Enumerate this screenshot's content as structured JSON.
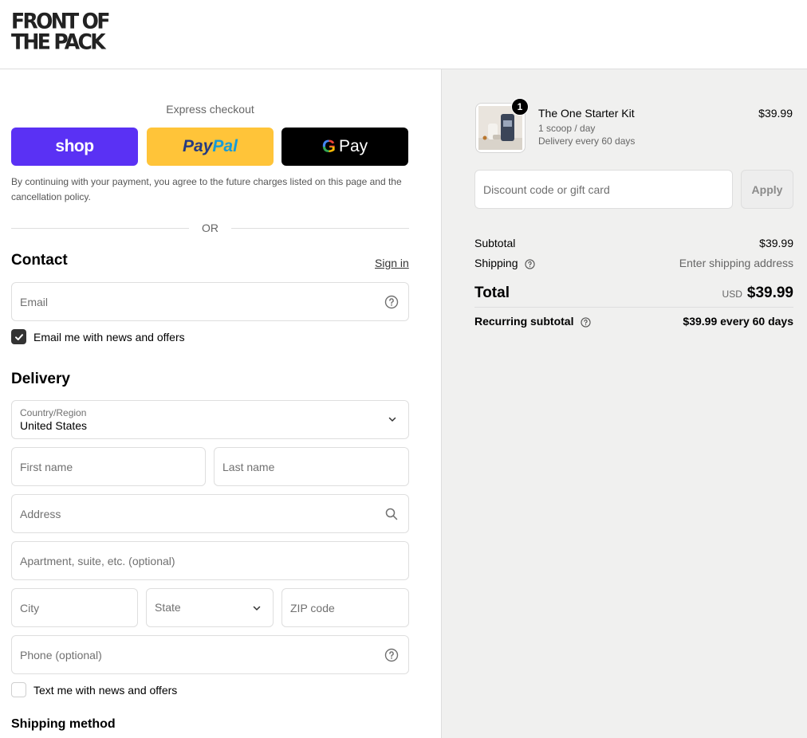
{
  "brand": {
    "logo_line1": "FRONT OF",
    "logo_line2": "THE PACK"
  },
  "express": {
    "title": "Express checkout",
    "shop_label": "shop",
    "paypal_part1": "Pay",
    "paypal_part2": "Pal",
    "gpay_g": "G",
    "gpay_label": "Pay",
    "terms": "By continuing with your payment, you agree to the future charges listed on this page and the cancellation policy.",
    "or_label": "OR"
  },
  "contact": {
    "title": "Contact",
    "sign_in": "Sign in",
    "email_placeholder": "Email",
    "news_label": "Email me with news and offers",
    "news_checked": true
  },
  "delivery": {
    "title": "Delivery",
    "country_label": "Country/Region",
    "country_value": "United States",
    "first_name_placeholder": "First name",
    "last_name_placeholder": "Last name",
    "address_placeholder": "Address",
    "apartment_placeholder": "Apartment, suite, etc. (optional)",
    "city_placeholder": "City",
    "state_placeholder": "State",
    "zip_placeholder": "ZIP code",
    "phone_placeholder": "Phone (optional)",
    "sms_label": "Text me with news and offers",
    "sms_checked": false
  },
  "shipping_method": {
    "title": "Shipping method"
  },
  "order": {
    "item": {
      "quantity": "1",
      "name": "The One Starter Kit",
      "option": "1 scoop / day",
      "delivery": "Delivery every 60 days",
      "price": "$39.99"
    },
    "discount_placeholder": "Discount code or gift card",
    "apply_label": "Apply",
    "subtotal_label": "Subtotal",
    "subtotal_value": "$39.99",
    "shipping_label": "Shipping",
    "shipping_value": "Enter shipping address",
    "total_label": "Total",
    "currency": "USD",
    "total_value": "$39.99",
    "recurring_label": "Recurring subtotal",
    "recurring_value": "$39.99 every 60 days"
  },
  "colors": {
    "shop_purple": "#5a31f4",
    "paypal_yellow": "#ffc439",
    "gpay_black": "#000000",
    "summary_bg": "#f0f0ef"
  },
  "icons": [
    "help-circle-icon",
    "chevron-down-icon",
    "search-icon",
    "check-icon",
    "question-icon"
  ]
}
